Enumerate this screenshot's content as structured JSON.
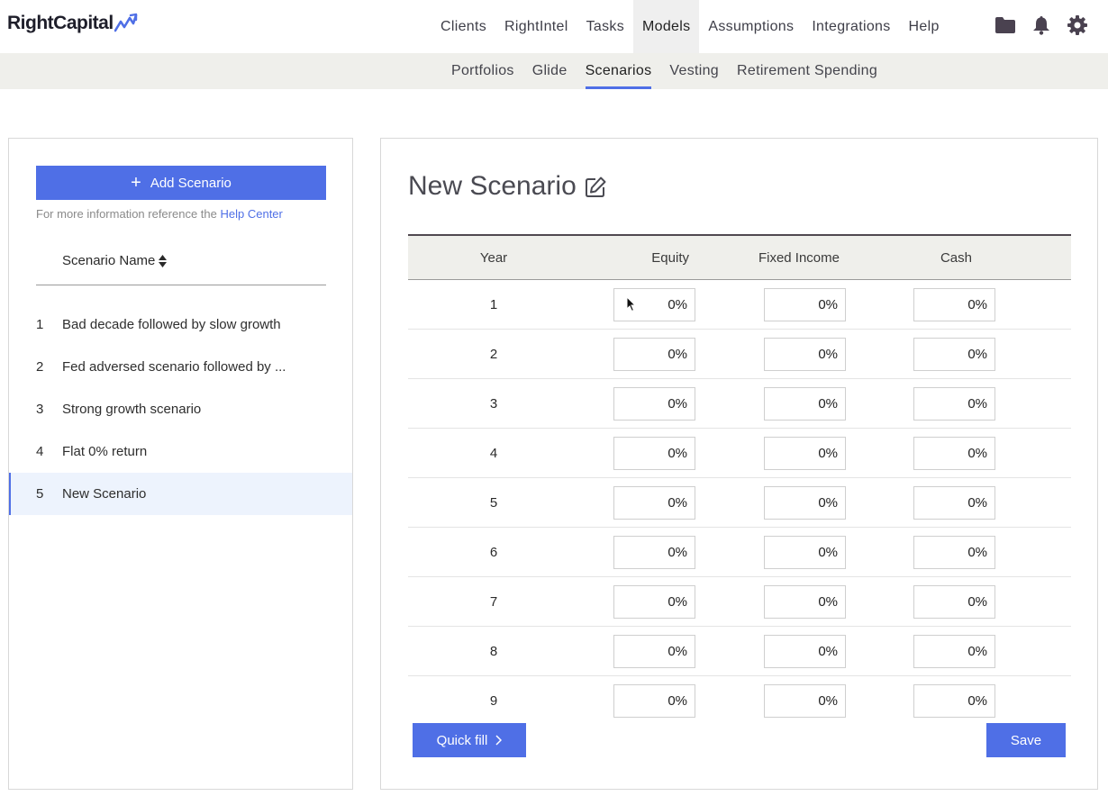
{
  "brand": {
    "name": "RightCapital",
    "accent_color": "#4f6fe6"
  },
  "topnav": {
    "items": [
      {
        "label": "Clients"
      },
      {
        "label": "RightIntel"
      },
      {
        "label": "Tasks"
      },
      {
        "label": "Models",
        "active": true
      },
      {
        "label": "Assumptions"
      },
      {
        "label": "Integrations"
      },
      {
        "label": "Help"
      }
    ],
    "icons": [
      "folder-icon",
      "bell-icon",
      "gear-icon"
    ]
  },
  "subnav": {
    "items": [
      {
        "label": "Portfolios"
      },
      {
        "label": "Glide"
      },
      {
        "label": "Scenarios",
        "active": true
      },
      {
        "label": "Vesting"
      },
      {
        "label": "Retirement Spending"
      }
    ]
  },
  "sidebar": {
    "add_button_label": "Add Scenario",
    "help_prefix": "For more information reference the",
    "help_link": "Help Center",
    "column_header": "Scenario Name",
    "items": [
      {
        "num": "1",
        "name": "Bad decade followed by slow growth"
      },
      {
        "num": "2",
        "name": "Fed adversed scenario followed by ..."
      },
      {
        "num": "3",
        "name": "Strong growth scenario"
      },
      {
        "num": "4",
        "name": "Flat 0% return"
      },
      {
        "num": "5",
        "name": "New Scenario",
        "selected": true
      }
    ]
  },
  "main": {
    "title": "New Scenario",
    "columns": [
      "Year",
      "Equity",
      "Fixed Income",
      "Cash"
    ],
    "rows": [
      {
        "year": "1",
        "equity": "0%",
        "fixed_income": "0%",
        "cash": "0%"
      },
      {
        "year": "2",
        "equity": "0%",
        "fixed_income": "0%",
        "cash": "0%"
      },
      {
        "year": "3",
        "equity": "0%",
        "fixed_income": "0%",
        "cash": "0%"
      },
      {
        "year": "4",
        "equity": "0%",
        "fixed_income": "0%",
        "cash": "0%"
      },
      {
        "year": "5",
        "equity": "0%",
        "fixed_income": "0%",
        "cash": "0%"
      },
      {
        "year": "6",
        "equity": "0%",
        "fixed_income": "0%",
        "cash": "0%"
      },
      {
        "year": "7",
        "equity": "0%",
        "fixed_income": "0%",
        "cash": "0%"
      },
      {
        "year": "8",
        "equity": "0%",
        "fixed_income": "0%",
        "cash": "0%"
      },
      {
        "year": "9",
        "equity": "0%",
        "fixed_income": "0%",
        "cash": "0%"
      }
    ],
    "quick_fill_label": "Quick fill",
    "save_label": "Save"
  }
}
